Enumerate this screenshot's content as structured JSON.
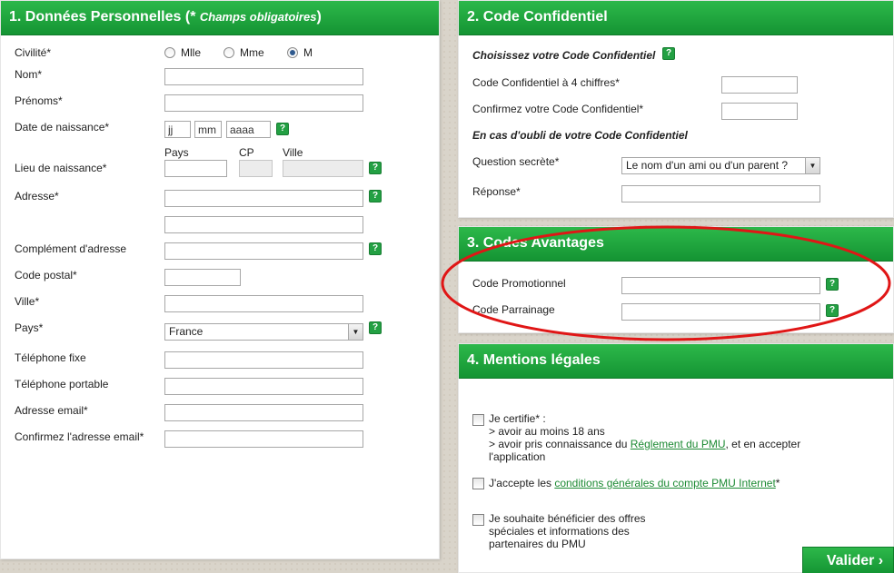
{
  "section1": {
    "title": "1. Données Personnelles",
    "hint_prefix": "(* ",
    "hint_text": "Champs obligatoires",
    "hint_suffix": ")",
    "civilite_label": "Civilité*",
    "civilite_options": [
      "Mlle",
      "Mme",
      "M"
    ],
    "civilite_selected": "M",
    "nom_label": "Nom*",
    "prenoms_label": "Prénoms*",
    "date_label": "Date de naissance*",
    "date_day": "jj",
    "date_month": "mm",
    "date_year": "aaaa",
    "lieu_label": "Lieu de naissance*",
    "pays_col": "Pays",
    "cp_col": "CP",
    "ville_col": "Ville",
    "adresse_label": "Adresse*",
    "complement_label": "Complément d'adresse",
    "code_postal_label": "Code postal*",
    "ville_label": "Ville*",
    "pays_label": "Pays*",
    "pays_value": "France",
    "tel_fixe_label": "Téléphone fixe",
    "tel_portable_label": "Téléphone portable",
    "email_label": "Adresse email*",
    "email_confirm_label": "Confirmez l'adresse email*"
  },
  "section2": {
    "title": "2. Code Confidentiel",
    "choose_title": "Choisissez votre Code Confidentiel",
    "code_label": "Code Confidentiel à 4 chiffres*",
    "confirm_label": "Confirmez votre Code Confidentiel*",
    "oubli_title": "En cas d'oubli de votre Code Confidentiel",
    "question_label": "Question secrète*",
    "question_value": "Le nom d'un ami ou d'un parent ?",
    "reponse_label": "Réponse*"
  },
  "section3": {
    "title": "3. Codes Avantages",
    "promo_label": "Code Promotionnel",
    "parrainage_label": "Code Parrainage"
  },
  "section4": {
    "title": "4. Mentions légales",
    "certify_line1": "Je certifie* :",
    "certify_line2": "> avoir au moins 18 ans",
    "certify_line3_prefix": "> avoir pris connaissance du ",
    "certify_line3_link": "Réglement du PMU",
    "certify_line3_suffix": ", et en accepter",
    "certify_line4": "l'application",
    "cgu_prefix": "J'accepte les ",
    "cgu_link": "conditions générales du compte PMU Internet",
    "cgu_suffix": "*",
    "offers_line1": "Je souhaite bénéficier des offres",
    "offers_line2": "spéciales et informations des",
    "offers_line3": "partenaires du PMU"
  },
  "help_glyph": "?",
  "submit_label": "Valider",
  "submit_arrow": "›",
  "colors": {
    "header_green": "#149433",
    "help_green": "#23a043",
    "annotation_red": "#e01616"
  }
}
